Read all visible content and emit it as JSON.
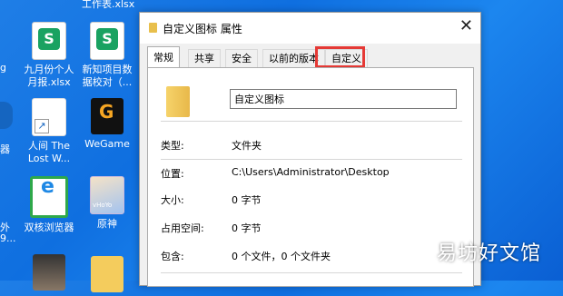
{
  "desktop": {
    "top_cut_label": "工作表.xlsx",
    "icons": [
      {
        "label": "九月份个人月报.xlsx",
        "type": "xls"
      },
      {
        "label": "新知项目数据校对（...",
        "type": "xls"
      },
      {
        "label": "人间 The Lost W...",
        "type": "shortcut"
      },
      {
        "label": "WeGame",
        "type": "wegame"
      },
      {
        "label": "双核浏览器",
        "type": "browser"
      },
      {
        "label": "原神",
        "type": "game"
      }
    ],
    "left_partial": [
      "g",
      "器",
      "外",
      "9..."
    ]
  },
  "dialog": {
    "title": "自定义图标 属性",
    "close_glyph": "✕",
    "tabs": [
      "常规",
      "共享",
      "安全",
      "以前的版本",
      "自定义"
    ],
    "active_tab": "常规",
    "highlighted_tab": "自定义",
    "name_value": "自定义图标",
    "rows": [
      {
        "label": "类型:",
        "value": "文件夹"
      },
      {
        "label": "位置:",
        "value": "C:\\Users\\Administrator\\Desktop"
      },
      {
        "label": "大小:",
        "value": "0 字节"
      },
      {
        "label": "占用空间:",
        "value": "0 字节"
      },
      {
        "label": "包含:",
        "value": "0 个文件，0 个文件夹"
      }
    ]
  },
  "watermark": "易坊好文馆",
  "colors": {
    "highlight": "#e53935",
    "desktop_blue": "#1f7ee6"
  }
}
